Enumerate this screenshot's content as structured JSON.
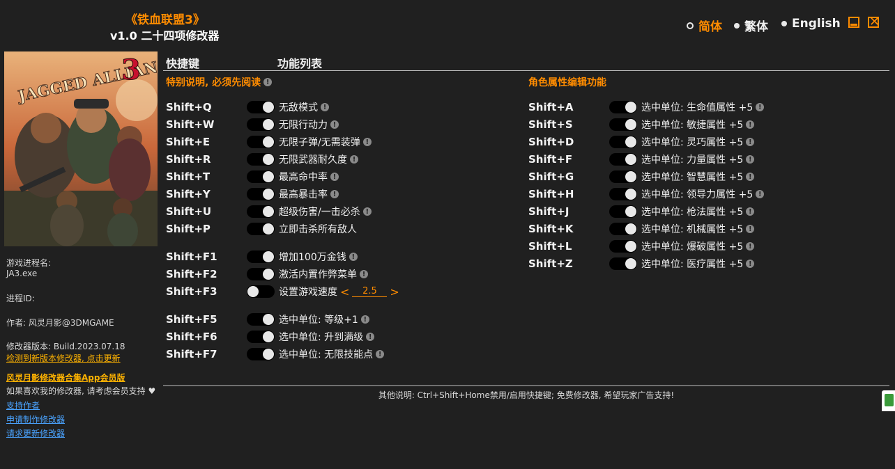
{
  "header": {
    "game_title": "《铁血联盟3》",
    "version_title": "v1.0 二十四项修改器",
    "languages": [
      "简体",
      "繁体",
      "English"
    ],
    "active_language": "简体"
  },
  "sidebar": {
    "process_name_label": "游戏进程名:",
    "process_name_value": "JA3.exe",
    "process_id_label": "进程ID:",
    "author": "作者: 风灵月影@3DMGAME",
    "build_version": "修改器版本: Build.2023.07.18",
    "update_link": "检测到新版本修改器, 点击更新",
    "app_link": "风灵月影修改器合集App会员版",
    "support_text": "如果喜欢我的修改器, 请考虑会员支持",
    "links": [
      "支持作者",
      "申请制作修改器",
      "请求更新修改器"
    ]
  },
  "columns": {
    "hotkey_header": "快捷键",
    "function_header": "功能列表"
  },
  "left_section": {
    "title": "特别说明, 必须先阅读",
    "groups": [
      [
        {
          "key": "Shift+Q",
          "label": "无敌模式",
          "info": true
        },
        {
          "key": "Shift+W",
          "label": "无限行动力",
          "info": true
        },
        {
          "key": "Shift+E",
          "label": "无限子弹/无需装弹",
          "info": true
        },
        {
          "key": "Shift+R",
          "label": "无限武器耐久度",
          "info": true
        },
        {
          "key": "Shift+T",
          "label": "最高命中率",
          "info": true
        },
        {
          "key": "Shift+Y",
          "label": "最高暴击率",
          "info": true
        },
        {
          "key": "Shift+U",
          "label": "超级伤害/一击必杀",
          "info": true
        },
        {
          "key": "Shift+P",
          "label": "立即击杀所有敌人",
          "info": false
        }
      ],
      [
        {
          "key": "Shift+F1",
          "label": "增加100万金钱",
          "info": true
        },
        {
          "key": "Shift+F2",
          "label": "激活内置作弊菜单",
          "info": true
        },
        {
          "key": "Shift+F3",
          "label": "设置游戏速度",
          "info": false,
          "speed": "2.5"
        }
      ],
      [
        {
          "key": "Shift+F5",
          "label": "选中单位: 等级+1",
          "info": true
        },
        {
          "key": "Shift+F6",
          "label": "选中单位: 升到满级",
          "info": true
        },
        {
          "key": "Shift+F7",
          "label": "选中单位: 无限技能点",
          "info": true
        }
      ]
    ]
  },
  "right_section": {
    "title": "角色属性编辑功能",
    "rows": [
      {
        "key": "Shift+A",
        "label": "选中单位: 生命值属性 +5",
        "info": true
      },
      {
        "key": "Shift+S",
        "label": "选中单位: 敏捷属性 +5",
        "info": true
      },
      {
        "key": "Shift+D",
        "label": "选中单位: 灵巧属性 +5",
        "info": true
      },
      {
        "key": "Shift+F",
        "label": "选中单位: 力量属性 +5",
        "info": true
      },
      {
        "key": "Shift+G",
        "label": "选中单位: 智慧属性 +5",
        "info": true
      },
      {
        "key": "Shift+H",
        "label": "选中单位: 领导力属性 +5",
        "info": true
      },
      {
        "key": "Shift+J",
        "label": "选中单位: 枪法属性 +5",
        "info": true
      },
      {
        "key": "Shift+K",
        "label": "选中单位: 机械属性 +5",
        "info": true
      },
      {
        "key": "Shift+L",
        "label": "选中单位: 爆破属性 +5",
        "info": true
      },
      {
        "key": "Shift+Z",
        "label": "选中单位: 医疗属性 +5",
        "info": true
      }
    ]
  },
  "footer": {
    "note": "其他说明: Ctrl+Shift+Home禁用/启用快捷键; 免费修改器, 希望玩家广告支持!"
  },
  "colors": {
    "accent": "#ff8c00",
    "background": "#202020",
    "link": "#4aa3ff",
    "update_link": "#ffb300"
  },
  "icons": {
    "info": "exclamation-circle-icon",
    "minimize": "minimize-icon",
    "close": "close-icon",
    "heart": "heart-icon"
  }
}
